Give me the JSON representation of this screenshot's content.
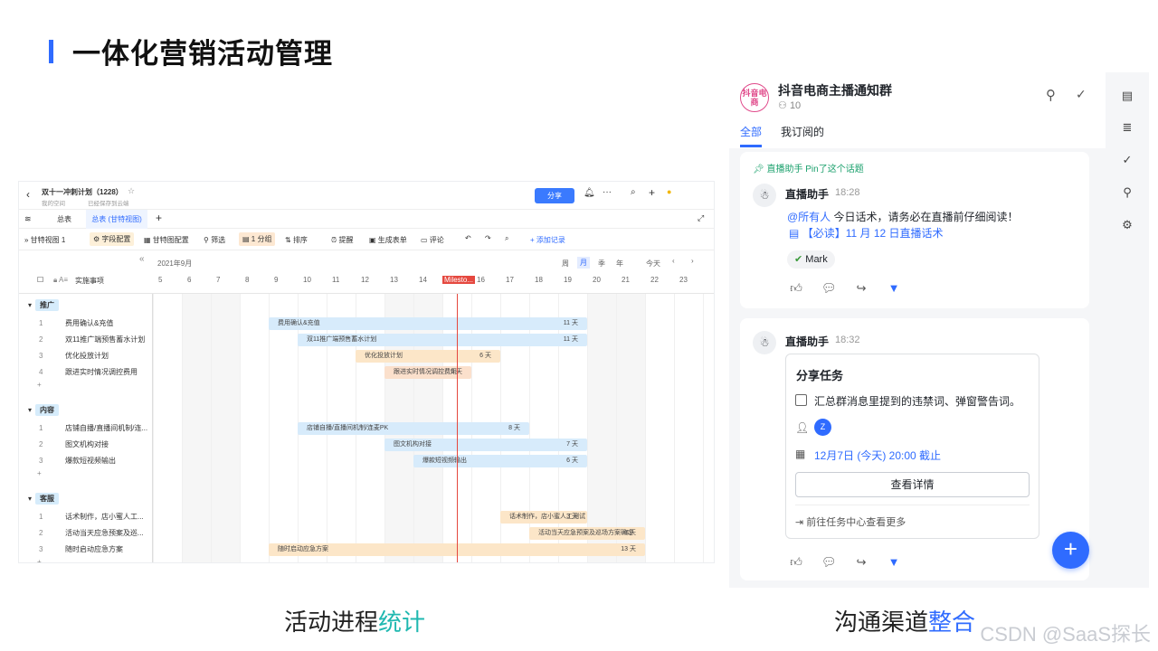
{
  "page": {
    "title": "一体化营销活动管理"
  },
  "captions": {
    "left_a": "活动进程",
    "left_b": "统计",
    "right_a": "沟通渠道",
    "right_b": "整合"
  },
  "watermark": "CSDN @SaaS探长",
  "gantt": {
    "doc_title": "双十一冲刺计划（1228）",
    "breadcrumb": "我的空间",
    "saved": "已经保存到云端",
    "share": "分享",
    "tabs": [
      "总表",
      "总表 (甘特视图)"
    ],
    "toolbar": {
      "view": "甘特视图 1",
      "field": "字段配置",
      "gantt_cfg": "甘特图配置",
      "filter": "筛选",
      "group": "1 分组",
      "sort": "排序",
      "remind": "提醒",
      "form": "生成表单",
      "comment": "评论",
      "add": "添加记录"
    },
    "month": "2021年9月",
    "scale": [
      "周",
      "月",
      "季",
      "年"
    ],
    "today": "今天",
    "col_header": "实施事项",
    "days": [
      "5",
      "6",
      "7",
      "8",
      "9",
      "10",
      "11",
      "12",
      "13",
      "14",
      "Milesto...",
      "16",
      "17",
      "18",
      "19",
      "20",
      "21",
      "22",
      "23"
    ],
    "groups": [
      {
        "name": "推广",
        "rows": [
          {
            "n": "1",
            "t": "费用确认&充值",
            "bar": "费用确认&充值",
            "dur": "11 天"
          },
          {
            "n": "2",
            "t": "双11推广端预售蓄水计划",
            "bar": "双11推广端预售蓄水计划",
            "dur": "11 天"
          },
          {
            "n": "3",
            "t": "优化投放计划",
            "bar": "优化投放计划",
            "dur": "6 天"
          },
          {
            "n": "4",
            "t": "跟进实时情况调控费用",
            "bar": "跟进实时情况调控费用",
            "dur": "5 天"
          }
        ]
      },
      {
        "name": "内容",
        "rows": [
          {
            "n": "1",
            "t": "店铺自播/直播间机制/连...",
            "bar": "店铺自播/直播间机制/连麦PK",
            "dur": "8 天"
          },
          {
            "n": "2",
            "t": "图文机构对接",
            "bar": "图文机构对接",
            "dur": "7 天"
          },
          {
            "n": "3",
            "t": "爆款短视频输出",
            "bar": "爆款短视频输出",
            "dur": "6 天"
          }
        ]
      },
      {
        "name": "客服",
        "rows": [
          {
            "n": "1",
            "t": "话术制作，店小蜜人工...",
            "bar": "话术制作，店小蜜人工测试",
            "dur": "3 天"
          },
          {
            "n": "2",
            "t": "活动当天应急预案及巡...",
            "bar": "活动当天应急预案及巡场方案确定",
            "dur": "3 天"
          },
          {
            "n": "3",
            "t": "随时启动应急方案",
            "bar": "随时启动应急方案",
            "dur": "13 天"
          }
        ]
      }
    ]
  },
  "chat": {
    "group_avatar": "抖音电商",
    "group_name": "抖音电商主播通知群",
    "members": "10",
    "tabs": [
      "全部",
      "我订阅的"
    ],
    "pin_note": "直播助手 Pin了这个话题",
    "msg1": {
      "sender": "直播助手",
      "time": "18:28",
      "mention": "@所有人",
      "text": " 今日话术，请务必在直播前仔细阅读！",
      "doc": "【必读】11 月 12 日直播话术",
      "reaction": "Mark"
    },
    "msg2": {
      "sender": "直播助手",
      "time": "18:32",
      "task_title": "分享任务",
      "task": "汇总群消息里提到的违禁词、弹窗警告词。",
      "assignee": "Z",
      "due": "12月7日 (今天) 20:00 截止",
      "detail_btn": "查看详情",
      "more": "前往任务中心查看更多"
    }
  },
  "colors": {
    "accent": "#2f6bff",
    "milestone": "#e5483f"
  }
}
